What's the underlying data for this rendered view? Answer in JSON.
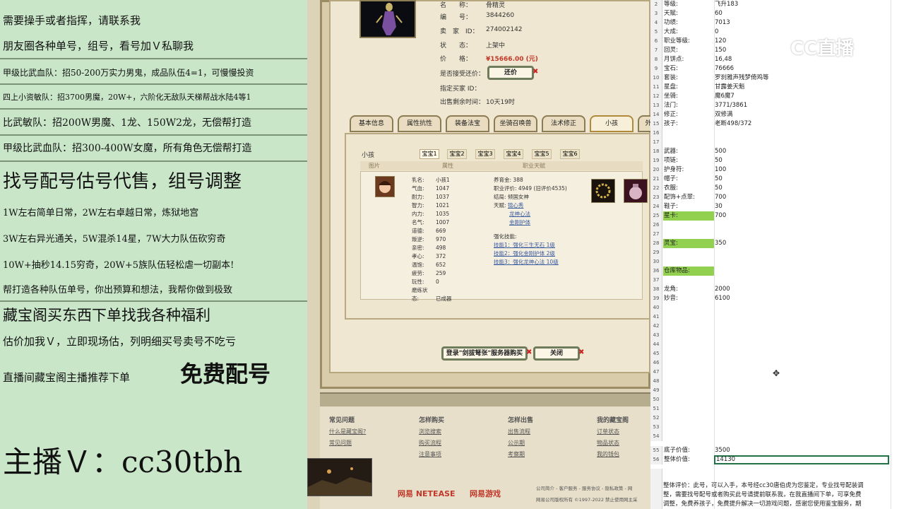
{
  "left_panel": {
    "lines": [
      "需要操手或者指挥，请联系我",
      "朋友圈各种单号，组号，看号加Ｖ私聊我",
      "甲级比武血队：招50-200万实力男鬼，成品队伍4=1，可慢慢投资",
      "四上小资敏队：招3700男魔，20W+，六阶化无敌队天梯帮战水陆4等1",
      "比武敏队：招200W男魔、1龙、150W2龙，无偿帮打造",
      "甲级比武血队：招300-400W女魔，所有角色无偿帮打造",
      "找号配号估号代售，组号调整",
      "1W左右简单日常，2W左右卓越日常，炼狱地宫",
      "3W左右异光通关，5W混杀14星，7W大力队伍砍穷奇",
      "10W+抽秒14.15穷奇，20W+5族队伍轻松虐一切副本!",
      "帮打造各种队伍单号，你出预算和想法，我帮你做到极致",
      "藏宝阁买东西下单找我各种福利",
      "估价加我Ｖ，立即现场估，列明细买号卖号不吃亏",
      "直播间藏宝阁主播推荐下单",
      "免费配号",
      "主播Ｖ：cc30tbh"
    ]
  },
  "game_window": {
    "info": {
      "name_label": "名　　称：",
      "name_value": "骨精灵",
      "id_label": "编　　号：",
      "id_value": "3844260",
      "seller_label": "卖　家　ID：",
      "seller_value": "274002142",
      "status_label": "状　　态：",
      "status_value": "上架中",
      "price_label": "价　　格：",
      "price_value": "¥15666.00 (元)",
      "bargain_label": "是否接受还价：",
      "bargain_button": "还价",
      "buyer_label": "指定买家 ID：",
      "remain_label": "出售剩余时间：",
      "remain_value": "10天19时"
    },
    "tabs": [
      "基本信息",
      "属性抗性",
      "装备法宝",
      "坐骑召唤兽",
      "法术修正",
      "小孩",
      "外"
    ],
    "active_tab": "小孩",
    "child_panel": {
      "title": "小孩",
      "subtabs": [
        "宝宝1",
        "宝宝2",
        "宝宝3",
        "宝宝4",
        "宝宝5",
        "宝宝6"
      ],
      "col_headers": [
        "图片",
        "属性",
        "职业天赋"
      ],
      "stats": [
        {
          "k": "乳名:",
          "v": "小孩1"
        },
        {
          "k": "气血:",
          "v": "1047"
        },
        {
          "k": "耐力:",
          "v": "1037"
        },
        {
          "k": "智力:",
          "v": "1021"
        },
        {
          "k": "内力:",
          "v": "1035"
        },
        {
          "k": "名气:",
          "v": "1007"
        },
        {
          "k": "道德:",
          "v": "669"
        },
        {
          "k": "叛逆:",
          "v": "970"
        },
        {
          "k": "亲密:",
          "v": "498"
        },
        {
          "k": "孝心:",
          "v": "372"
        },
        {
          "k": "温饱:",
          "v": "652"
        },
        {
          "k": "疲劳:",
          "v": "259"
        },
        {
          "k": "玩性:",
          "v": "0"
        },
        {
          "k": "磨练状态:",
          "v": "已成器"
        }
      ],
      "right": {
        "nurture_label": "养育金:",
        "nurture_value": "388",
        "score_label": "职业评价:",
        "score_value": "4949 (旧评价4535)",
        "end_label": "结局:",
        "end_value": "倾国女神",
        "talent_label": "天赋:",
        "talents": [
          "锦心秀",
          "龙神心法",
          "金刚护体"
        ],
        "skill_label": "强化技能:",
        "skills": [
          "技能1：强化三生无石 1级",
          "技能2：强化金刚护体 2级",
          "技能3：强化龙神心法 10级"
        ]
      }
    },
    "buttons": {
      "login": "登录\"剑拔弩张\"服务器购买",
      "close": "关闭"
    },
    "footer": {
      "cols": [
        {
          "title": "常见问题",
          "links": [
            "什么是藏宝阁?",
            "常见问题"
          ]
        },
        {
          "title": "怎样购买",
          "links": [
            "浏览搜索",
            "购买流程",
            "注意事项"
          ]
        },
        {
          "title": "怎样出售",
          "links": [
            "出售流程",
            "公示期",
            "考察期"
          ]
        },
        {
          "title": "我的藏宝阁",
          "links": [
            "订单状态",
            "物品状态",
            "我的钱包"
          ]
        }
      ],
      "brand1": "网易 NETEASE",
      "brand2": "网易游戏",
      "copyright1": "公司简介 - 客户服务 - 服务协议 - 隐私政策 - 网",
      "copyright2": "网易公司版权所有 ©1997-2022 禁止使用网主采"
    }
  },
  "sheet": {
    "rows": [
      {
        "n": "2",
        "a": "等级:",
        "b": "飞升183"
      },
      {
        "n": "3",
        "a": "天赋:",
        "b": "60"
      },
      {
        "n": "4",
        "a": "功绩:",
        "b": "7013"
      },
      {
        "n": "5",
        "a": "大成:",
        "b": "0"
      },
      {
        "n": "6",
        "a": "职业等级:",
        "b": "120"
      },
      {
        "n": "7",
        "a": "回灵:",
        "b": "150"
      },
      {
        "n": "8",
        "a": "月饼点:",
        "b": "16,48"
      },
      {
        "n": "9",
        "a": "宝石:",
        "b": "76666"
      },
      {
        "n": "10",
        "a": "套装:",
        "b": "罗刹雅声残梦倚鸡等"
      },
      {
        "n": "11",
        "a": "星盘:",
        "b": "甘露姜天魁"
      },
      {
        "n": "12",
        "a": "坐骑:",
        "b": "魔6魔7"
      },
      {
        "n": "13",
        "a": "法门:",
        "b": "3771/3861"
      },
      {
        "n": "14",
        "a": "修正:",
        "b": "双修满"
      },
      {
        "n": "15",
        "a": "孩子:",
        "b": "老断498/372"
      },
      {
        "n": "16",
        "a": "",
        "b": ""
      },
      {
        "n": "17",
        "a": "",
        "b": ""
      },
      {
        "n": "18",
        "a": "武器:",
        "b": "500"
      },
      {
        "n": "19",
        "a": "项链:",
        "b": "50"
      },
      {
        "n": "20",
        "a": "护身符:",
        "b": "100"
      },
      {
        "n": "21",
        "a": "帽子:",
        "b": "50"
      },
      {
        "n": "22",
        "a": "衣服:",
        "b": "50"
      },
      {
        "n": "23",
        "a": "配饰+点翠:",
        "b": "700"
      },
      {
        "n": "24",
        "a": "鞋子:",
        "b": "30"
      },
      {
        "n": "25",
        "a": "星卡:",
        "b": "700",
        "hl": true
      },
      {
        "n": "26",
        "a": "",
        "b": ""
      },
      {
        "n": "27",
        "a": "",
        "b": ""
      },
      {
        "n": "28",
        "a": "灵宝:",
        "b": "350",
        "hl": true
      },
      {
        "n": "29",
        "a": "",
        "b": ""
      },
      {
        "n": "30",
        "a": "",
        "b": ""
      },
      {
        "n": "36",
        "a": "仓库物品:",
        "b": "",
        "hl": true
      },
      {
        "n": "37",
        "a": "",
        "b": ""
      },
      {
        "n": "38",
        "a": "龙角:",
        "b": "2000"
      },
      {
        "n": "39",
        "a": "妙音:",
        "b": "6100"
      },
      {
        "n": "40",
        "a": "",
        "b": ""
      },
      {
        "n": "41",
        "a": "",
        "b": ""
      },
      {
        "n": "42",
        "a": "",
        "b": ""
      },
      {
        "n": "43",
        "a": "",
        "b": ""
      },
      {
        "n": "44",
        "a": "",
        "b": ""
      },
      {
        "n": "45",
        "a": "",
        "b": ""
      },
      {
        "n": "46",
        "a": "",
        "b": ""
      },
      {
        "n": "47",
        "a": "",
        "b": ""
      },
      {
        "n": "48",
        "a": "",
        "b": ""
      },
      {
        "n": "49",
        "a": "",
        "b": ""
      },
      {
        "n": "50",
        "a": "",
        "b": ""
      },
      {
        "n": "51",
        "a": "",
        "b": ""
      },
      {
        "n": "52",
        "a": "",
        "b": ""
      },
      {
        "n": "53",
        "a": "",
        "b": ""
      },
      {
        "n": "54",
        "a": "",
        "b": ""
      },
      {
        "n": "55",
        "a": "底子价值:",
        "b": "3500"
      },
      {
        "n": "56",
        "a": "整体价值:",
        "b": "14130",
        "sel": true
      },
      {
        "n": "57",
        "a": "",
        "b": ""
      }
    ],
    "summary_lines": [
      "整体评价：此号，可以入手，本号经cc30唐伯虎为您鉴定，专业找号配装调",
      "整，需要找号配号或者购买此号请提前联系我，在我直播间下单，可享免费",
      "调整，免费养孩子，免费提升解决一切游戏问题，感谢您使用鉴宝服务，期"
    ]
  },
  "watermark": "CC直播",
  "colors": {
    "left_bg": "#c9e6c9",
    "sheet_highlight": "#92d050",
    "price_red": "#c0392b",
    "frame": "#9c8c66"
  }
}
